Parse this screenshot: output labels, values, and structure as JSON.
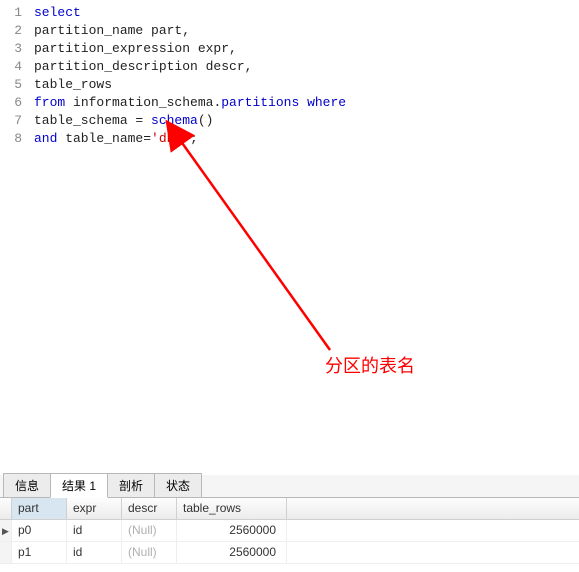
{
  "editor": {
    "lineNumbers": [
      "1",
      "2",
      "3",
      "4",
      "5",
      "6",
      "7",
      "8"
    ],
    "tokens": [
      [
        {
          "t": "select",
          "c": "k-blue"
        }
      ],
      [
        {
          "t": "partition_name part,",
          "c": "k-black"
        }
      ],
      [
        {
          "t": "partition_expression expr,",
          "c": "k-black"
        }
      ],
      [
        {
          "t": "partition_description descr,",
          "c": "k-black"
        }
      ],
      [
        {
          "t": "table_rows",
          "c": "k-black"
        }
      ],
      [
        {
          "t": "from",
          "c": "k-blue"
        },
        {
          "t": " information_schema.",
          "c": "k-black"
        },
        {
          "t": "partitions",
          "c": "k-blue"
        },
        {
          "t": " ",
          "c": "k-black"
        },
        {
          "t": "where",
          "c": "k-blue"
        }
      ],
      [
        {
          "t": "table_schema = ",
          "c": "k-black"
        },
        {
          "t": "schema",
          "c": "k-blue"
        },
        {
          "t": "()",
          "c": "k-black"
        }
      ],
      [
        {
          "t": "and",
          "c": "k-blue"
        },
        {
          "t": " table_name=",
          "c": "k-black"
        },
        {
          "t": "'db1'",
          "c": "k-red"
        },
        {
          "t": ";",
          "c": "k-black"
        }
      ]
    ]
  },
  "annotation": "分区的表名",
  "tabs": {
    "items": [
      {
        "label": "信息",
        "active": false
      },
      {
        "label": "结果 1",
        "active": true
      },
      {
        "label": "剖析",
        "active": false
      },
      {
        "label": "状态",
        "active": false
      }
    ]
  },
  "results": {
    "columns": [
      "part",
      "expr",
      "descr",
      "table_rows"
    ],
    "rows": [
      {
        "marker": "▶",
        "part": "p0",
        "expr": "id",
        "descr": "(Null)",
        "table_rows": "2560000"
      },
      {
        "marker": "",
        "part": "p1",
        "expr": "id",
        "descr": "(Null)",
        "table_rows": "2560000"
      }
    ]
  }
}
